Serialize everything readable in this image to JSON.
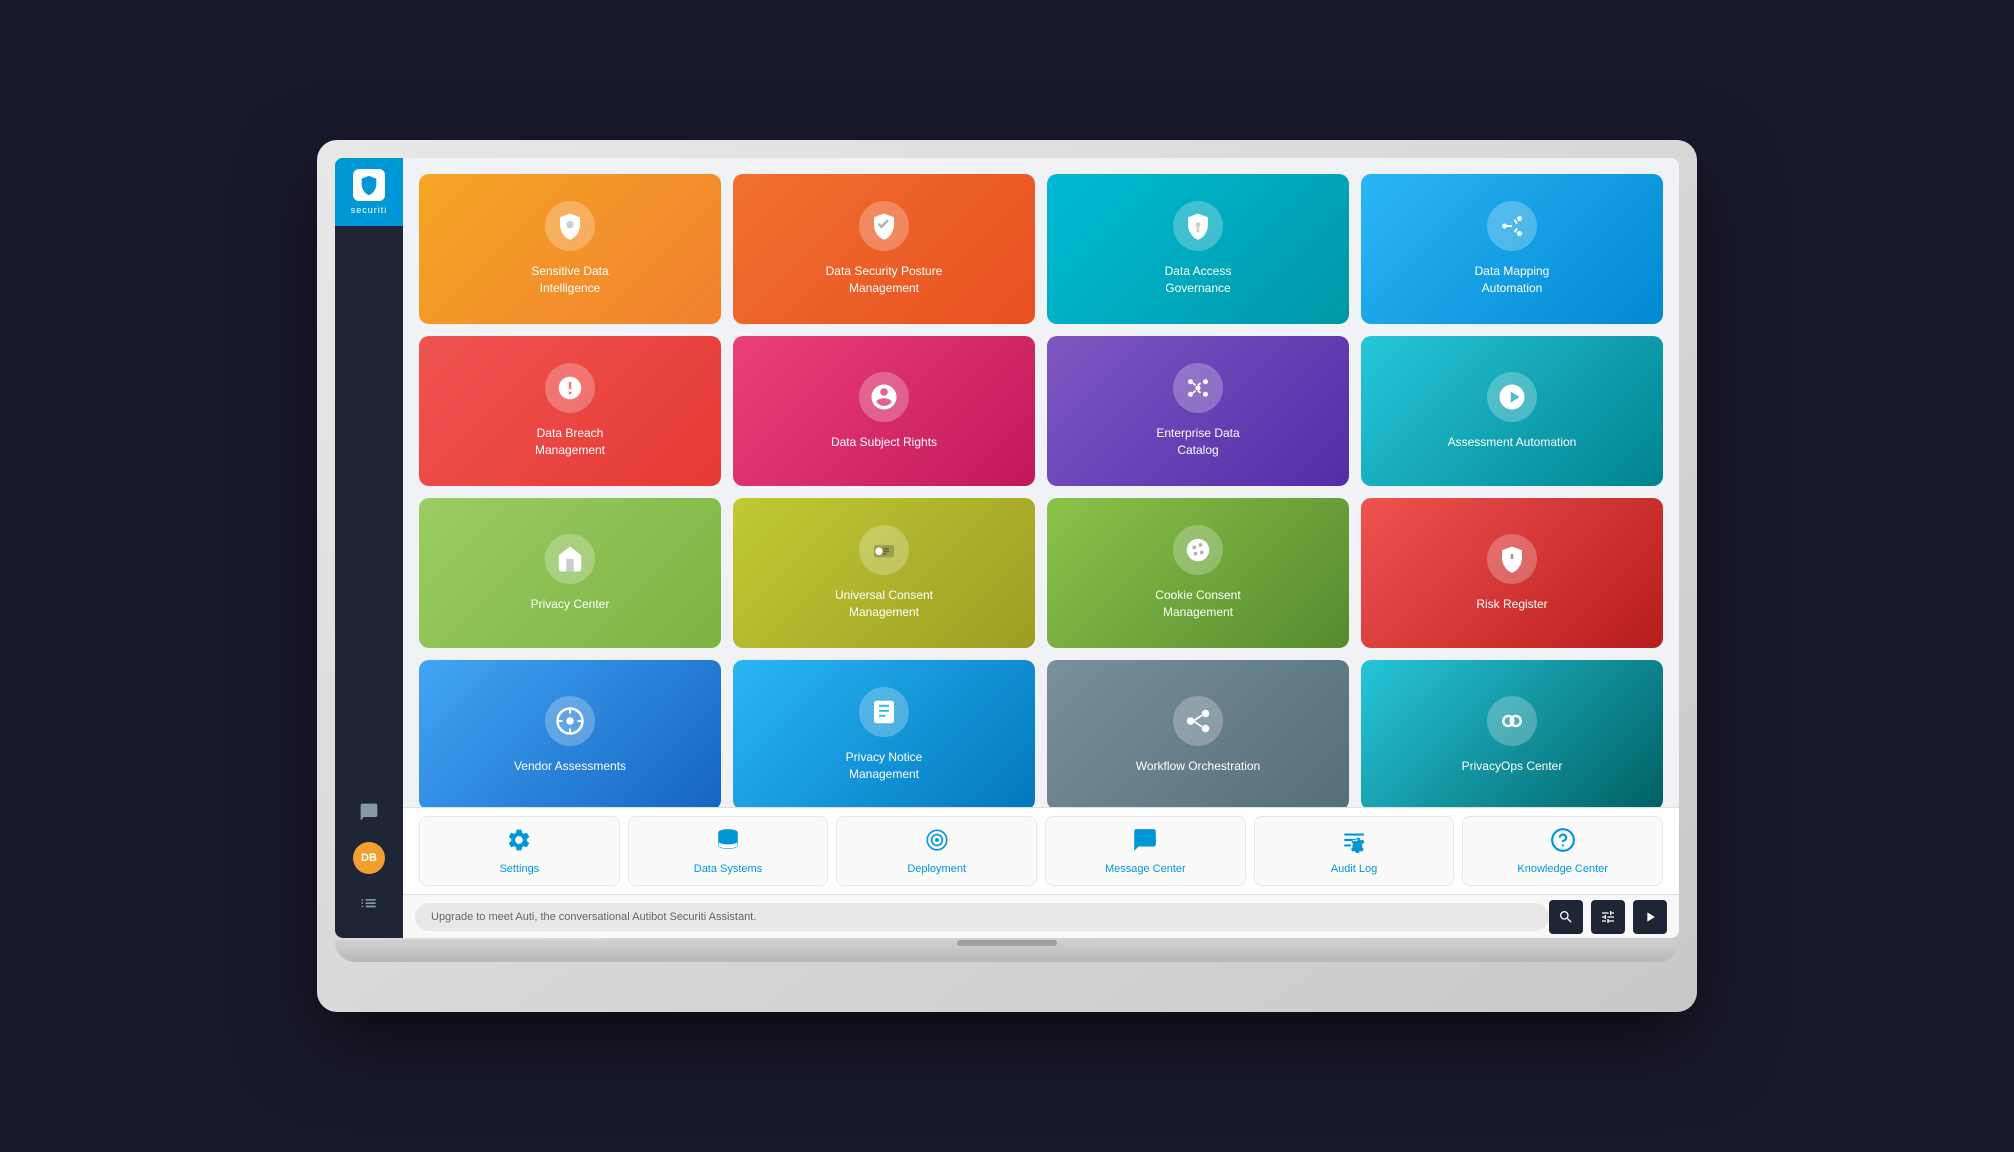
{
  "sidebar": {
    "logo_text": "securiti",
    "bottom_icons": [
      "chat-icon",
      "avatar-icon",
      "grid-icon"
    ]
  },
  "avatar": {
    "initials": "DB"
  },
  "cards": {
    "row1": [
      {
        "id": "sensitive-data-intelligence",
        "label": "Sensitive Data Intelligence",
        "color": "card-orange",
        "icon": "🔶"
      },
      {
        "id": "data-security-posture",
        "label": "Data Security Posture Management",
        "color": "card-orange-red",
        "icon": "🛡"
      },
      {
        "id": "data-access-governance",
        "label": "Data Access Governance",
        "color": "card-teal",
        "icon": "🔐"
      },
      {
        "id": "data-mapping-automation",
        "label": "Data Mapping Automation",
        "color": "card-blue-light",
        "icon": "📊"
      }
    ],
    "row2": [
      {
        "id": "data-breach-management",
        "label": "Data Breach Management",
        "color": "card-red-orange",
        "icon": "📡"
      },
      {
        "id": "data-subject-rights",
        "label": "Data Subject Rights",
        "color": "card-pink",
        "icon": "⚙"
      },
      {
        "id": "enterprise-data-catalog",
        "label": "Enterprise Data Catalog",
        "color": "card-purple",
        "icon": "🔮"
      },
      {
        "id": "assessment-automation",
        "label": "Assessment Automation",
        "color": "card-blue-cyan",
        "icon": "🔄"
      }
    ],
    "row3": [
      {
        "id": "privacy-center",
        "label": "Privacy Center",
        "color": "card-green-lime",
        "icon": "⬡"
      },
      {
        "id": "universal-consent",
        "label": "Universal Consent Management",
        "color": "card-yellow-green",
        "icon": "🔀"
      },
      {
        "id": "cookie-consent",
        "label": "Cookie Consent Management",
        "color": "card-green",
        "icon": "🍪"
      },
      {
        "id": "risk-register",
        "label": "Risk Register",
        "color": "card-red-deep",
        "icon": "⚠"
      }
    ],
    "row4": [
      {
        "id": "vendor-assessments",
        "label": "Vendor Assessments",
        "color": "card-blue-med",
        "icon": "⚙"
      },
      {
        "id": "privacy-notice",
        "label": "Privacy Notice Management",
        "color": "card-blue",
        "icon": "📋"
      },
      {
        "id": "workflow-orchestration",
        "label": "Workflow Orchestration",
        "color": "card-grey",
        "icon": "🔗"
      },
      {
        "id": "privacyops-center",
        "label": "PrivacyOps Center",
        "color": "card-blue-dark",
        "icon": "👁"
      }
    ]
  },
  "utility": [
    {
      "id": "settings",
      "label": "Settings",
      "icon": "⚙"
    },
    {
      "id": "data-systems",
      "label": "Data Systems",
      "icon": "🗄"
    },
    {
      "id": "deployment",
      "label": "Deployment",
      "icon": "⚙"
    },
    {
      "id": "message-center",
      "label": "Message Center",
      "icon": "💬"
    },
    {
      "id": "audit-log",
      "label": "Audit Log",
      "icon": "≡"
    },
    {
      "id": "knowledge-center",
      "label": "Knowledge Center",
      "icon": "?"
    }
  ],
  "bottom_bar": {
    "chat_text": "Upgrade to meet Auti, the conversational Autibot Securiti Assistant."
  }
}
